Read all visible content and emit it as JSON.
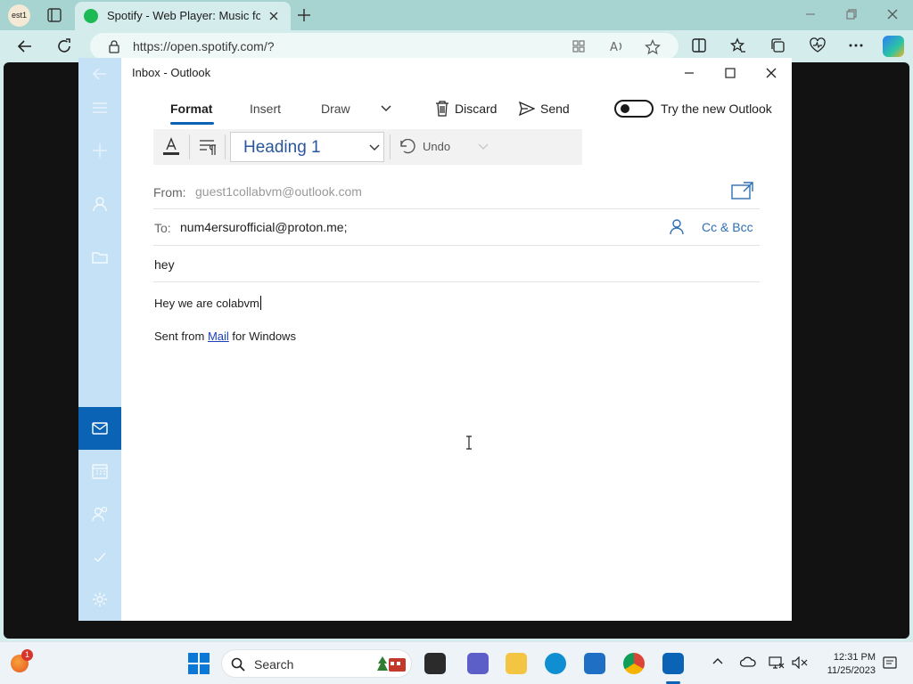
{
  "browser": {
    "profile_label": "est1",
    "tab_title": "Spotify - Web Player: Music for e",
    "url": "https://open.spotify.com/?"
  },
  "mail_window": {
    "title": "Inbox - Outlook",
    "tabs": [
      "Format",
      "Insert",
      "Draw"
    ],
    "discard_label": "Discard",
    "send_label": "Send",
    "toggle_label": "Try the new Outlook",
    "toggle_on": false
  },
  "toolbar": {
    "style": "Heading 1",
    "undo_label": "Undo"
  },
  "compose": {
    "from_label": "From:",
    "from_value": "guest1collabvm@outlook.com",
    "to_label": "To:",
    "to_value": "num4ersurofficial@proton.me;",
    "cc_bcc_label": "Cc & Bcc",
    "subject": "hey",
    "body_text": "Hey we are colabvm",
    "signature_prefix": "Sent from ",
    "signature_link": "Mail",
    "signature_suffix": " for Windows"
  },
  "taskbar": {
    "weather_badge": "1",
    "search_label": "Search",
    "time": "12:31 PM",
    "date": "11/25/2023"
  },
  "colors": {
    "accent": "#0a63b4",
    "rail": "#c4e1f6",
    "link": "#1a3fb8"
  }
}
